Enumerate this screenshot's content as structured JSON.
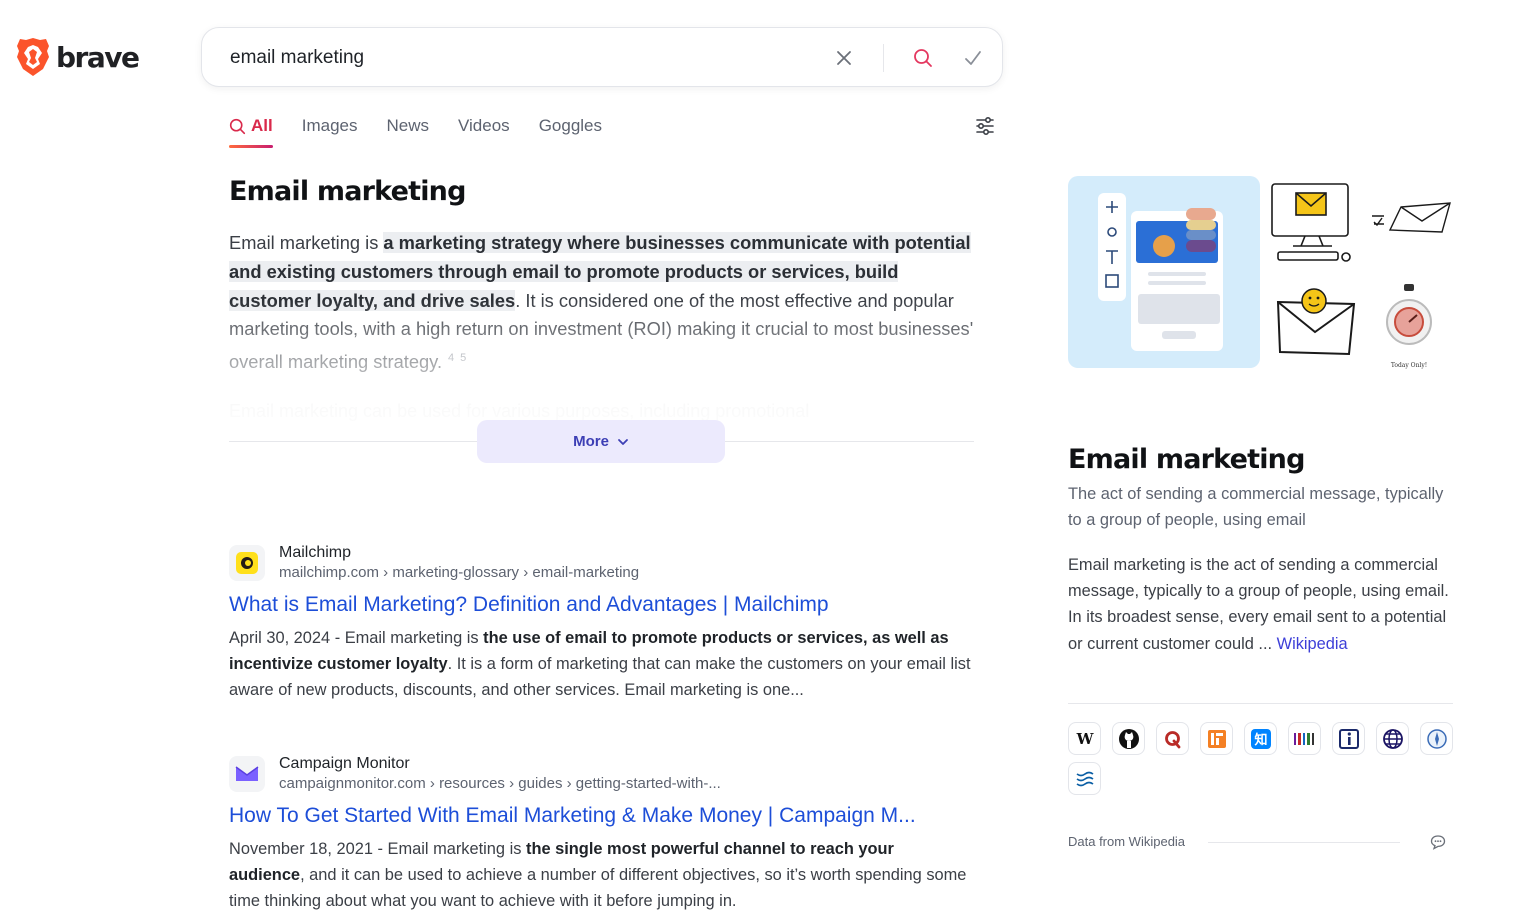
{
  "logo": {
    "word": "brave"
  },
  "search": {
    "value": "email marketing",
    "clear_icon": "close-icon",
    "search_icon": "search-icon",
    "submit_icon": "check-icon"
  },
  "tabs": [
    {
      "label": "All",
      "active": true,
      "icon": "search-icon"
    },
    {
      "label": "Images"
    },
    {
      "label": "News"
    },
    {
      "label": "Videos"
    },
    {
      "label": "Goggles"
    }
  ],
  "summary": {
    "title": "Email marketing",
    "intro": "Email marketing is ",
    "highlight": "a marketing strategy where businesses communicate with potential and existing customers through email to promote products or services, build customer loyalty, and drive sales",
    "rest": ". It is considered one of the most effective and popular marketing tools, with a high return on investment (ROI) making it crucial to most businesses' overall marketing strategy.",
    "cite_a": "4",
    "cite_b": "5",
    "faded": "Email marketing can be used for various purposes, including promotional",
    "more_label": "More"
  },
  "results": [
    {
      "site": "Mailchimp",
      "url": "mailchimp.com › marketing-glossary › email-marketing",
      "title": "What is Email Marketing? Definition and Advantages | Mailchimp",
      "date": "April 30, 2024 - ",
      "pre": "Email marketing is ",
      "bold": "the use of email to promote products or services, as well as incentivize customer loyalty",
      "post": ". It is a form of marketing that can make the customers on your email list aware of new products, discounts, and other services. Email marketing is one..."
    },
    {
      "site": "Campaign Monitor",
      "url": "campaignmonitor.com › resources › guides › getting-started-with-...",
      "title": "How To Get Started With Email Marketing & Make Money | Campaign M...",
      "date": "November 18, 2021 - ",
      "pre": "Email marketing is ",
      "bold": "the single most powerful channel to reach your audience",
      "post": ", and it can be used to achieve a number of different objectives, so it’s worth spending some time thinking about what you want to achieve with it before jumping in."
    }
  ],
  "knowledge_panel": {
    "title": "Email marketing",
    "subtitle": "The act of sending a commercial message, typically to a group of people, using email",
    "description": "Email marketing is the act of sending a commercial message, typically to a group of people, using email. In its broadest sense, every email sent to a potential or current customer could ... ",
    "link": "Wikipedia",
    "image_caption": "Today Only!",
    "source": "Data from Wikipedia",
    "icons": [
      "wikipedia-icon",
      "github-icon",
      "quora-icon",
      "stackoverflow-icon",
      "zhihu-icon",
      "barcode-icon",
      "info-icon",
      "globe-icon",
      "compass-icon",
      "wave-icon"
    ]
  },
  "colors": {
    "accent": "#d9294b",
    "link": "#1d4ed8",
    "more_bg": "#eceafd",
    "brave_orange": "#fb542b"
  }
}
